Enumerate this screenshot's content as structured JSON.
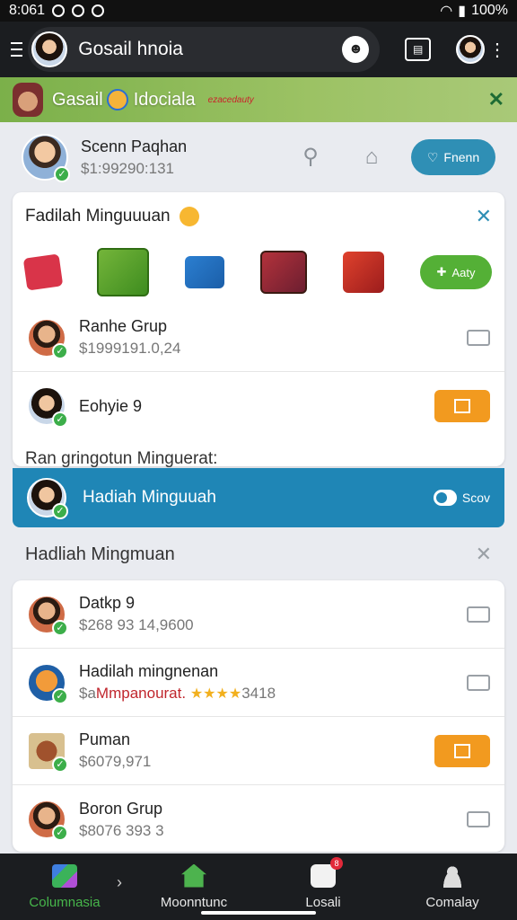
{
  "status": {
    "time": "8:061",
    "battery": "100%"
  },
  "appbar": {
    "title": "Gosail hnoia"
  },
  "banner": {
    "title": "Gasail",
    "title2": "Idociala",
    "tag": "ezacedauty"
  },
  "profile": {
    "name": "Scenn Paqhan",
    "sub": "$1:99290:131",
    "button": "Fnenn"
  },
  "card1": {
    "title": "Fadilah Minguuuan",
    "add_label": "Aaty",
    "rows": [
      {
        "name": "Ranhe Grup",
        "sub": "$1999191.0,24"
      },
      {
        "name": "Eohyie 9",
        "sub": ""
      }
    ],
    "note": "Ran gringotun Minguerat:"
  },
  "selected": {
    "label": "Hadiah Minguuah",
    "score": "Scov"
  },
  "section2": {
    "title": "Hadliah Mingmuan"
  },
  "card2": {
    "rows": [
      {
        "name": "Datkp 9",
        "sub": "$268 93 14,9600"
      },
      {
        "name": "Hadilah mingnenan",
        "sub_prefix": "$a",
        "sub_red": "Mmpanourat.",
        "stars": "★★★★",
        "sub_suffix": "3418"
      },
      {
        "name": "Puman",
        "sub": "$6079,971"
      },
      {
        "name": "Boron Grup",
        "sub": "$8076 393 3"
      }
    ]
  },
  "nav": [
    {
      "label": "Columnasia"
    },
    {
      "label": "Moonntunc"
    },
    {
      "label": "Losali",
      "badge": "8"
    },
    {
      "label": "Comalay"
    }
  ]
}
